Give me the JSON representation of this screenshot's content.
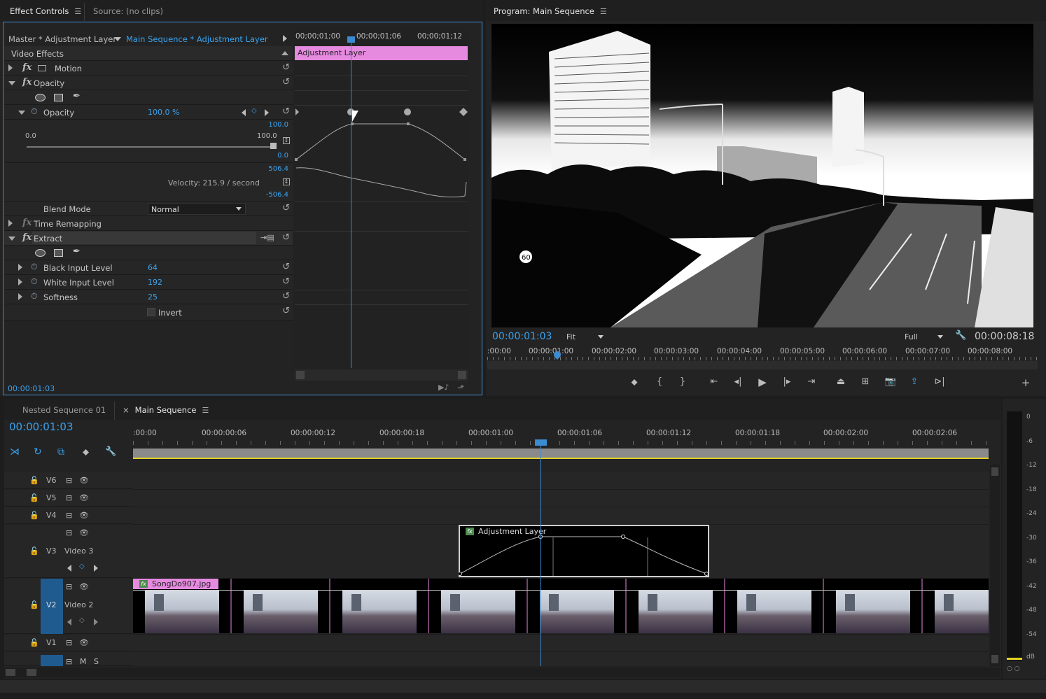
{
  "effect_controls": {
    "tab_label": "Effect Controls",
    "source_tab_label": "Source: (no clips)",
    "master_label": "Master * Adjustment Layer",
    "sequence_label": "Main Sequence * Adjustment Layer",
    "ruler": [
      "00;00;01;00",
      "00;00;01;06",
      "00;00;01;12"
    ],
    "clip_bar_label": "Adjustment Layer",
    "video_effects_label": "Video Effects",
    "motion_label": "Motion",
    "opacity_group_label": "Opacity",
    "opacity_label": "Opacity",
    "opacity_value": "100.0 %",
    "graph_top": "100.0",
    "graph_bottom": "0.0",
    "slider_min": "0.0",
    "slider_max": "100.0",
    "velocity_top": "506.4",
    "velocity_bottom": "-506.4",
    "velocity_label": "Velocity: 215.9 / second",
    "blend_mode_label": "Blend Mode",
    "blend_mode_value": "Normal",
    "time_remap_label": "Time Remapping",
    "extract_label": "Extract",
    "black_input_label": "Black Input Level",
    "black_input_value": "64",
    "white_input_label": "White Input Level",
    "white_input_value": "192",
    "softness_label": "Softness",
    "softness_value": "25",
    "invert_label": "Invert",
    "current_time": "00:00:01:03"
  },
  "program_monitor": {
    "title": "Program: Main Sequence",
    "current_time": "00:00:01:03",
    "fit_value": "Fit",
    "quality_value": "Full",
    "duration": "00:00:08:18",
    "ruler": [
      ":00:00",
      "00:00:01:00",
      "00:00:02:00",
      "00:00:03:00",
      "00:00:04:00",
      "00:00:05:00",
      "00:00:06:00",
      "00:00:07:00",
      "00:00:08:00"
    ]
  },
  "timeline": {
    "tab_nested": "Nested Sequence 01",
    "tab_main": "Main Sequence",
    "close_glyph": "×",
    "current_time": "00:00:01:03",
    "ruler": [
      ":00:00",
      "00:00:00:06",
      "00:00:00:12",
      "00:00:00:18",
      "00:00:01:00",
      "00:00:01:06",
      "00:00:01:12",
      "00:00:01:18",
      "00:00:02:00",
      "00:00:02:06"
    ],
    "tracks": {
      "v6": "V6",
      "v5": "V5",
      "v4": "V4",
      "v3": "V3",
      "v3_name": "Video 3",
      "v2": "V2",
      "v2_name": "Video 2",
      "v1": "V1"
    },
    "adjustment_clip_label": "Adjustment Layer",
    "image_clip_label": "SongDo907.jpg",
    "audio_m": "M",
    "audio_s": "S"
  },
  "audio_meter": {
    "scale": [
      "0",
      "-6",
      "-12",
      "-18",
      "-24",
      "-30",
      "-36",
      "-42",
      "-48",
      "-54"
    ],
    "unit": "dB"
  },
  "colors": {
    "accent_blue": "#39a0ec",
    "clip_pink": "#e68ae0",
    "work_area_yellow": "#e3d324"
  }
}
